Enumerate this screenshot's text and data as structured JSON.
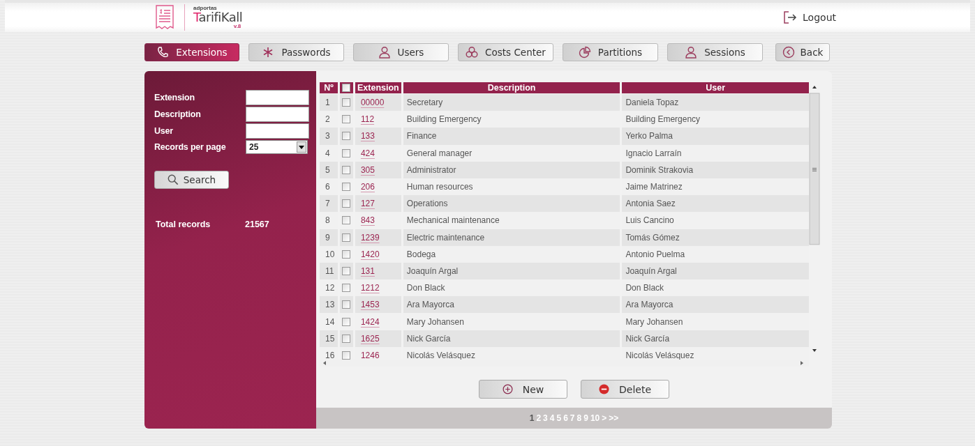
{
  "header": {
    "brand_small": "adportas",
    "brand": "TarifiKall",
    "version": "v.8",
    "logout": "Logout"
  },
  "tabs": [
    {
      "label": "Extensions",
      "kind": "phone",
      "selected": true
    },
    {
      "label": "Passwords",
      "kind": "asterisk",
      "selected": false
    },
    {
      "label": "Users",
      "kind": "user",
      "selected": false
    },
    {
      "label": "Costs Center",
      "kind": "circles",
      "selected": false
    },
    {
      "label": "Partitions",
      "kind": "pie",
      "selected": false
    },
    {
      "label": "Sessions",
      "kind": "user",
      "selected": false
    },
    {
      "label": "Back",
      "kind": "back",
      "selected": false
    }
  ],
  "filters": [
    {
      "label": "Extension",
      "kind": "text"
    },
    {
      "label": "Description",
      "kind": "text"
    },
    {
      "label": "User",
      "kind": "text"
    },
    {
      "label": "Records per page",
      "kind": "select",
      "value": "25"
    }
  ],
  "search_button": "Search",
  "total": {
    "label": "Total records",
    "value": "21567"
  },
  "table": {
    "columns": [
      "Nº",
      "Extension",
      "Description",
      "User"
    ],
    "all_checked": false,
    "rows": [
      {
        "n": "1",
        "checked": false,
        "extension": "00000",
        "description": "Secretary",
        "user": "Daniela Topaz"
      },
      {
        "n": "2",
        "checked": false,
        "extension": "112",
        "description": "Building Emergency",
        "user": "Building Emergency"
      },
      {
        "n": "3",
        "checked": false,
        "extension": "133",
        "description": "Finance",
        "user": "Yerko Palma"
      },
      {
        "n": "4",
        "checked": false,
        "extension": "424",
        "description": "General manager",
        "user": "Ignacio Larraín"
      },
      {
        "n": "5",
        "checked": false,
        "extension": "305",
        "description": "Administrator",
        "user": "Dominik Strakovia"
      },
      {
        "n": "6",
        "checked": false,
        "extension": "206",
        "description": "Human resources",
        "user": "Jaime Matrinez"
      },
      {
        "n": "7",
        "checked": false,
        "extension": "127",
        "description": "Operations",
        "user": "Antonia Saez"
      },
      {
        "n": "8",
        "checked": false,
        "extension": "843",
        "description": "Mechanical maintenance",
        "user": "Luis Cancino"
      },
      {
        "n": "9",
        "checked": false,
        "extension": "1239",
        "description": "Electric maintenance",
        "user": "Tomás Gómez"
      },
      {
        "n": "10",
        "checked": false,
        "extension": "1420",
        "description": "Bodega",
        "user": "Antonio Puelma"
      },
      {
        "n": "11",
        "checked": false,
        "extension": "131",
        "description": "Joaquín Argal",
        "user": "Joaquín Argal"
      },
      {
        "n": "12",
        "checked": false,
        "extension": "1212",
        "description": "Don Black",
        "user": "Don Black"
      },
      {
        "n": "13",
        "checked": false,
        "extension": "1453",
        "description": "Ara Mayorca",
        "user": "Ara Mayorca"
      },
      {
        "n": "14",
        "checked": false,
        "extension": "1424",
        "description": "Mary Johansen",
        "user": "Mary Johansen"
      },
      {
        "n": "15",
        "checked": false,
        "extension": "1625",
        "description": "Nick García",
        "user": "Nick García"
      },
      {
        "n": "16",
        "checked": false,
        "extension": "1246",
        "description": "Nicolás Velásquez",
        "user": "Nicolás Velásquez"
      }
    ]
  },
  "actions": [
    {
      "label": "New",
      "kind": "add"
    },
    {
      "label": "Delete",
      "kind": "delete"
    }
  ],
  "pages": [
    {
      "label": "1",
      "selected": true
    },
    {
      "label": "2",
      "selected": false
    },
    {
      "label": "3",
      "selected": false
    },
    {
      "label": "4",
      "selected": false
    },
    {
      "label": "5",
      "selected": false
    },
    {
      "label": "6",
      "selected": false
    },
    {
      "label": "7",
      "selected": false
    },
    {
      "label": "8",
      "selected": false
    },
    {
      "label": "9",
      "selected": false
    },
    {
      "label": "10",
      "selected": false
    },
    {
      "label": ">",
      "selected": false
    },
    {
      "label": ">>",
      "selected": false
    }
  ]
}
